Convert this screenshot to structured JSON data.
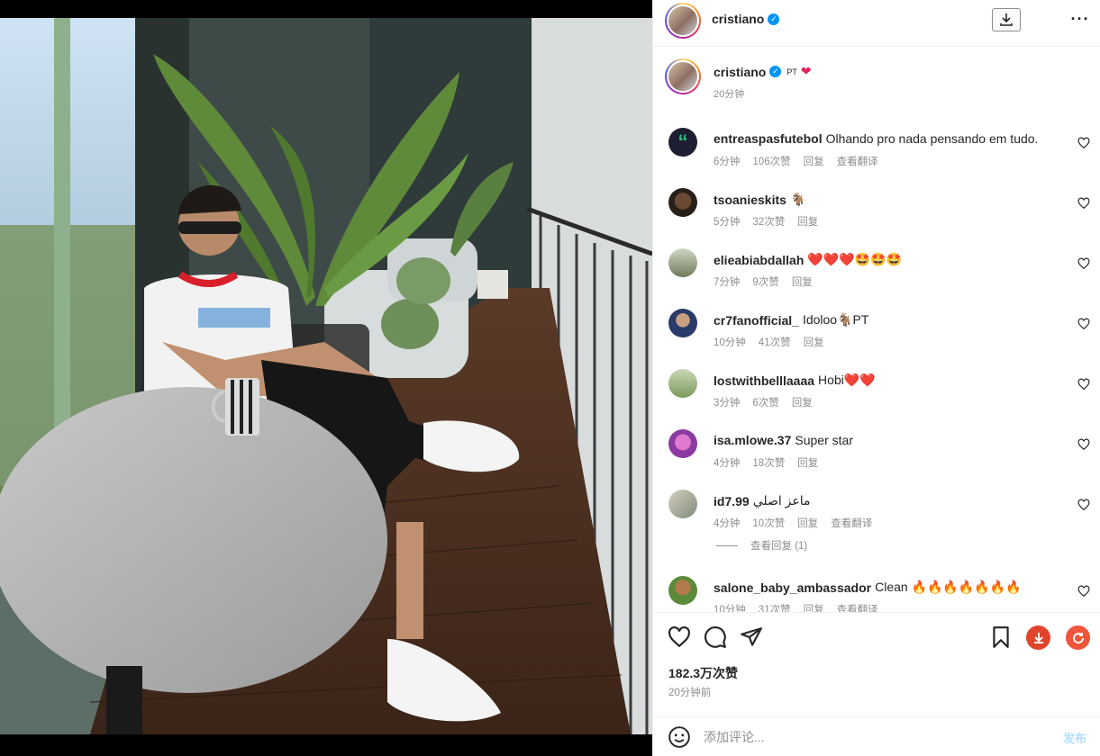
{
  "post": {
    "author": "cristiano",
    "verified_icon": "verified-badge-icon",
    "caption_username": "cristiano",
    "caption_text": "PT",
    "caption_time": "20分钟",
    "likes": "182.3万次赞",
    "posted_ago": "20分钟前"
  },
  "comments": [
    {
      "user": "entreaspasfutebol",
      "text": "Olhando pro nada pensando em tudo.",
      "time": "6分钟",
      "likes": "106次赞",
      "reply": "回复",
      "translate": "查看翻译",
      "avatar_color": "#1e1e32"
    },
    {
      "user": "tsoanieskits",
      "text": "🐐",
      "time": "5分钟",
      "likes": "32次赞",
      "reply": "回复",
      "translate": "",
      "avatar_color": "#3a2a20"
    },
    {
      "user": "elieabiabdallah",
      "text": "❤️❤️❤️🤩🤩🤩",
      "time": "7分钟",
      "likes": "9次赞",
      "reply": "回复",
      "translate": "",
      "avatar_color": "#7c8a6a"
    },
    {
      "user": "cr7fanofficial_",
      "text": "Idoloo🐐PT",
      "time": "10分钟",
      "likes": "41次赞",
      "reply": "回复",
      "translate": "",
      "avatar_color": "#3f51b5"
    },
    {
      "user": "lostwithbelllaaaa",
      "text": "Hobi❤️❤️",
      "time": "3分钟",
      "likes": "6次赞",
      "reply": "回复",
      "translate": "",
      "avatar_color": "#8aa57a"
    },
    {
      "user": "isa.mlowe.37",
      "text": "Super star",
      "time": "4分钟",
      "likes": "18次赞",
      "reply": "回复",
      "translate": "",
      "avatar_color": "#b04aa6"
    },
    {
      "user": "id7.99",
      "text": "ماعز اصلي",
      "time": "4分钟",
      "likes": "10次赞",
      "reply": "回复",
      "translate": "查看翻译",
      "avatar_color": "#9c8f7a"
    },
    {
      "user": "salone_baby_ambassador",
      "text": "Clean 🔥🔥🔥🔥🔥🔥🔥",
      "time": "10分钟",
      "likes": "31次赞",
      "reply": "回复",
      "translate": "查看翻译",
      "avatar_color": "#8a6a3a"
    }
  ],
  "view_replies": "查看回复 (1)",
  "comment_input": {
    "placeholder": "添加评论...",
    "post_label": "发布"
  },
  "colors": {
    "accent": "#0095f6",
    "muted": "#8e8e8e",
    "download_red": "#e0452b",
    "refresh_red": "#f0543a"
  }
}
